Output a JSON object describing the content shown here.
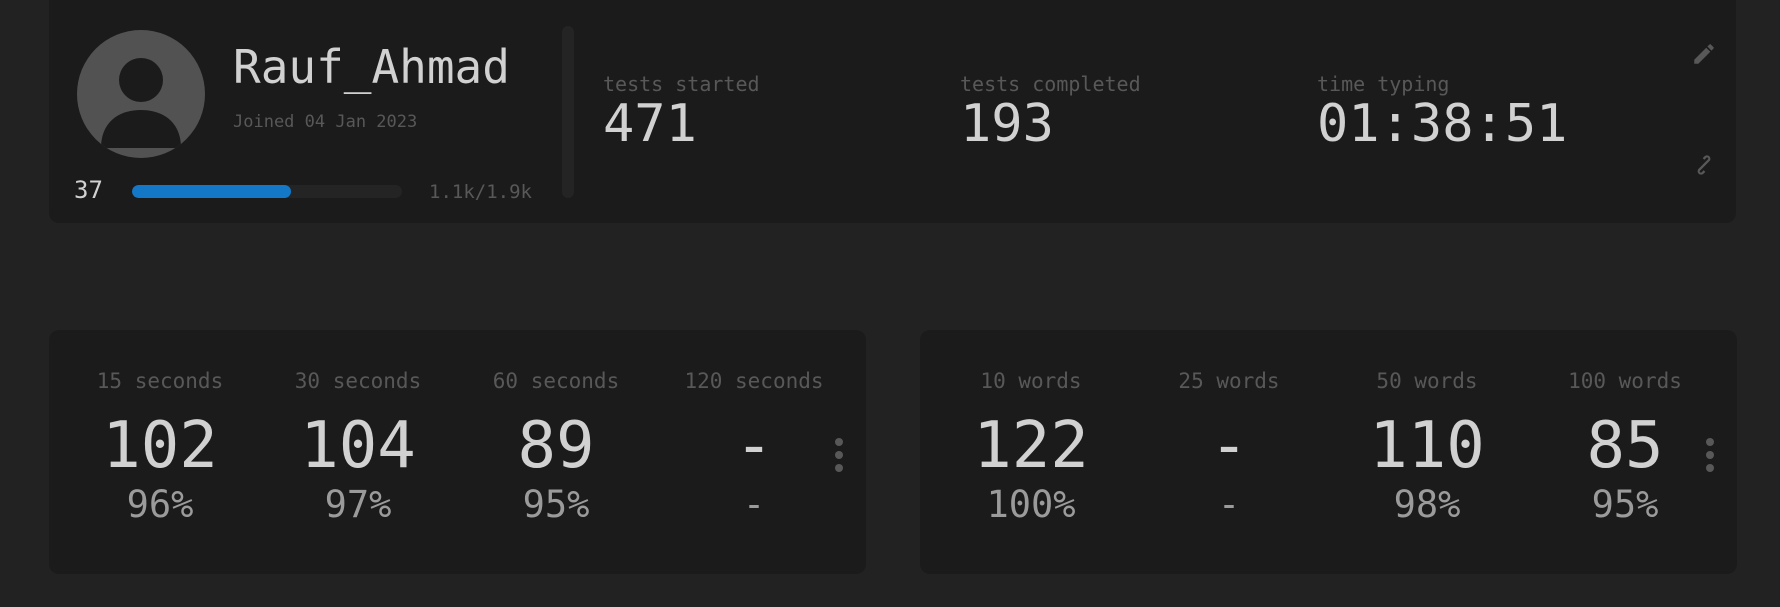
{
  "profile": {
    "username": "Rauf_Ahmad",
    "joined": "Joined 04 Jan 2023",
    "level": "37",
    "xp_text": "1.1k/1.9k",
    "xp_progress": 0.59
  },
  "stats": {
    "tests_started": {
      "label": "tests started",
      "value": "471"
    },
    "tests_completed": {
      "label": "tests completed",
      "value": "193"
    },
    "time_typing": {
      "label": "time typing",
      "value": "01:38:51"
    }
  },
  "actions": {
    "edit_icon": "pencil-icon",
    "link_icon": "link-icon"
  },
  "time_pbs": [
    {
      "label": "15 seconds",
      "wpm": "102",
      "acc": "96%"
    },
    {
      "label": "30 seconds",
      "wpm": "104",
      "acc": "97%"
    },
    {
      "label": "60 seconds",
      "wpm": "89",
      "acc": "95%"
    },
    {
      "label": "120 seconds",
      "wpm": "-",
      "acc": "-"
    }
  ],
  "words_pbs": [
    {
      "label": "10 words",
      "wpm": "122",
      "acc": "100%"
    },
    {
      "label": "25 words",
      "wpm": "-",
      "acc": "-"
    },
    {
      "label": "50 words",
      "wpm": "110",
      "acc": "98%"
    },
    {
      "label": "100 words",
      "wpm": "85",
      "acc": "95%"
    }
  ],
  "colors": {
    "background": "#222222",
    "card": "#1b1b1b",
    "accent": "#1478c8",
    "text": "#d1d1d1",
    "subtext": "#585858"
  }
}
